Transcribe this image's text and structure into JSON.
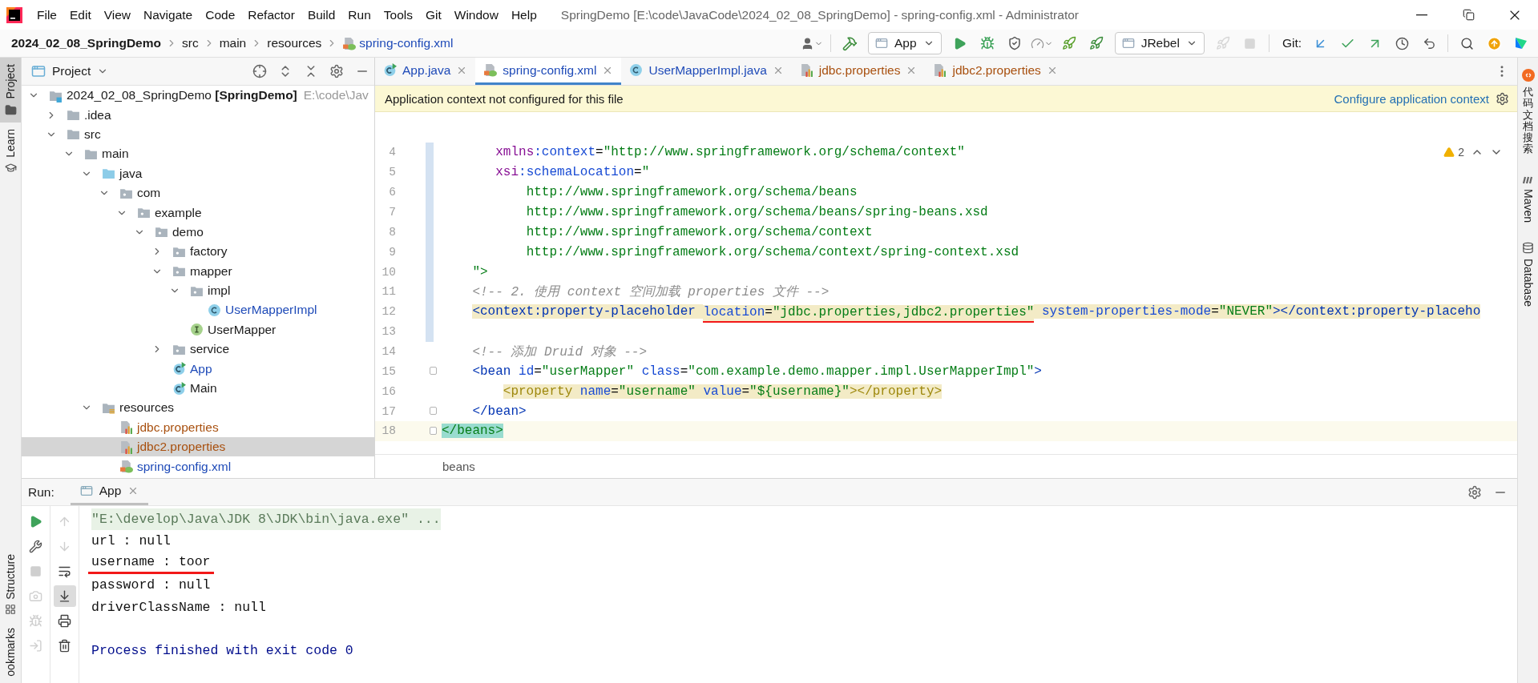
{
  "title_bar": {
    "menu": [
      "File",
      "Edit",
      "View",
      "Navigate",
      "Code",
      "Refactor",
      "Build",
      "Run",
      "Tools",
      "Git",
      "Window",
      "Help"
    ],
    "title": "SpringDemo [E:\\code\\JavaCode\\2024_02_08_SpringDemo] - spring-config.xml - Administrator"
  },
  "nav_bar": {
    "breadcrumbs": [
      {
        "label": "2024_02_08_SpringDemo",
        "kind": "project"
      },
      {
        "label": "src",
        "kind": "folder"
      },
      {
        "label": "main",
        "kind": "folder"
      },
      {
        "label": "resources",
        "kind": "folder"
      },
      {
        "label": "spring-config.xml",
        "kind": "file"
      }
    ],
    "tools": [
      {
        "kind": "user",
        "disabled": false
      },
      {
        "kind": "build",
        "disabled": false
      },
      {
        "kind": "dropdown",
        "label": "App"
      },
      {
        "kind": "run",
        "disabled": false
      },
      {
        "kind": "debug",
        "disabled": false
      },
      {
        "kind": "coverage",
        "disabled": false
      },
      {
        "kind": "profile",
        "disabled": false
      },
      {
        "kind": "jrebel-run",
        "disabled": false
      },
      {
        "kind": "jrebel-debug",
        "disabled": false
      },
      {
        "kind": "dropdown",
        "label": "JRebel"
      },
      {
        "kind": "deploy",
        "disabled": true
      },
      {
        "kind": "stop",
        "disabled": true
      },
      {
        "kind": "label",
        "label": "Git:"
      },
      {
        "kind": "git-update",
        "disabled": false
      },
      {
        "kind": "git-commit",
        "disabled": false
      },
      {
        "kind": "git-push",
        "disabled": false
      },
      {
        "kind": "history",
        "disabled": false
      },
      {
        "kind": "rollback",
        "disabled": false
      },
      {
        "kind": "search",
        "disabled": false
      },
      {
        "kind": "ide-update",
        "disabled": false
      },
      {
        "kind": "logo",
        "disabled": false
      }
    ]
  },
  "left_strip": {
    "top": [
      {
        "label": "Project",
        "kind": "project",
        "selected": true
      },
      {
        "label": "Learn",
        "kind": "learn",
        "selected": false
      }
    ],
    "bottom": [
      {
        "label": "Structure",
        "kind": "structure",
        "selected": false
      },
      {
        "label": "ookmarks",
        "kind": "bookmarks",
        "selected": false
      }
    ]
  },
  "project_panel": {
    "title": "Project",
    "tree": [
      {
        "label": "2024_02_08_SpringDemo",
        "module": "[SpringDemo]",
        "path": "E:\\code\\Jav",
        "kind": "module",
        "expanded": true,
        "selected": false,
        "children": [
          {
            "label": ".idea",
            "kind": "folder",
            "expanded": false,
            "selected": false
          },
          {
            "label": "src",
            "kind": "folder",
            "expanded": true,
            "selected": false,
            "children": [
              {
                "label": "main",
                "kind": "folder",
                "expanded": true,
                "selected": false,
                "children": [
                  {
                    "label": "java",
                    "kind": "source",
                    "expanded": true,
                    "selected": false,
                    "children": [
                      {
                        "label": "com",
                        "kind": "package",
                        "expanded": true,
                        "selected": false,
                        "children": [
                          {
                            "label": "example",
                            "kind": "package",
                            "expanded": true,
                            "selected": false,
                            "children": [
                              {
                                "label": "demo",
                                "kind": "package",
                                "expanded": true,
                                "selected": false,
                                "children": [
                                  {
                                    "label": "factory",
                                    "kind": "package",
                                    "expanded": false,
                                    "selected": false
                                  },
                                  {
                                    "label": "mapper",
                                    "kind": "package",
                                    "expanded": true,
                                    "selected": false,
                                    "children": [
                                      {
                                        "label": "impl",
                                        "kind": "package",
                                        "expanded": true,
                                        "selected": false,
                                        "children": [
                                          {
                                            "label": "UserMapperImpl",
                                            "kind": "class",
                                            "color": "#1f4bb8",
                                            "selected": false
                                          }
                                        ]
                                      },
                                      {
                                        "label": "UserMapper",
                                        "kind": "interface",
                                        "selected": false
                                      }
                                    ]
                                  },
                                  {
                                    "label": "service",
                                    "kind": "package",
                                    "expanded": false,
                                    "selected": false
                                  },
                                  {
                                    "label": "App",
                                    "kind": "runnable",
                                    "color": "#1f4bb8",
                                    "selected": false
                                  },
                                  {
                                    "label": "Main",
                                    "kind": "runnable",
                                    "selected": false
                                  }
                                ]
                              }
                            ]
                          }
                        ]
                      }
                    ]
                  },
                  {
                    "label": "resources",
                    "kind": "resources",
                    "expanded": true,
                    "selected": false,
                    "children": [
                      {
                        "label": "jdbc.properties",
                        "kind": "properties",
                        "color": "#a8500f",
                        "selected": false
                      },
                      {
                        "label": "jdbc2.properties",
                        "kind": "properties",
                        "color": "#a8500f",
                        "selected": true
                      },
                      {
                        "label": "spring-config.xml",
                        "kind": "xml",
                        "color": "#1f4bb8",
                        "selected": false
                      }
                    ]
                  }
                ]
              }
            ]
          }
        ]
      }
    ]
  },
  "editor": {
    "tabs": [
      {
        "label": "App.java",
        "kind": "runnable",
        "color": "#1f4bb8",
        "selected": false
      },
      {
        "label": "spring-config.xml",
        "kind": "xml",
        "color": "#1f4bb8",
        "selected": true
      },
      {
        "label": "UserMapperImpl.java",
        "kind": "class",
        "color": "#1f4bb8",
        "selected": false
      },
      {
        "label": "jdbc.properties",
        "kind": "properties",
        "color": "#a8500f",
        "selected": false
      },
      {
        "label": "jdbc2.properties",
        "kind": "properties",
        "color": "#a8500f",
        "selected": false
      }
    ],
    "banner": {
      "message": "Application context not configured for this file",
      "action": "Configure application context"
    },
    "warnings": "2",
    "lines": [
      {
        "number": "4",
        "changed": true,
        "tokens": [
          {
            "text": "       xmlns",
            "kind": "ns"
          },
          {
            "text": ":context",
            "kind": "attr"
          },
          {
            "text": "=",
            "kind": "text"
          },
          {
            "text": "\"http://www.springframework.org/schema/context\"",
            "kind": "value"
          }
        ]
      },
      {
        "number": "5",
        "changed": true,
        "tokens": [
          {
            "text": "       xsi",
            "kind": "ns"
          },
          {
            "text": ":schemaLocation",
            "kind": "attr"
          },
          {
            "text": "=",
            "kind": "text"
          },
          {
            "text": "\"",
            "kind": "value"
          }
        ]
      },
      {
        "number": "6",
        "changed": true,
        "tokens": [
          {
            "text": "           http://www.springframework.org/schema/beans",
            "kind": "value"
          }
        ]
      },
      {
        "number": "7",
        "changed": true,
        "tokens": [
          {
            "text": "           http://www.springframework.org/schema/beans/spring-beans.xsd",
            "kind": "value"
          }
        ]
      },
      {
        "number": "8",
        "changed": true,
        "tokens": [
          {
            "text": "           http://www.springframework.org/schema/context",
            "kind": "value"
          }
        ]
      },
      {
        "number": "9",
        "changed": true,
        "tokens": [
          {
            "text": "           http://www.springframework.org/schema/context/spring-context.xsd",
            "kind": "value"
          }
        ]
      },
      {
        "number": "10",
        "changed": true,
        "tokens": [
          {
            "text": "    \">",
            "kind": "value"
          }
        ]
      },
      {
        "number": "11",
        "changed": true,
        "tokens": [
          {
            "text": "    <!-- 2. 使用 context 空间加载 properties 文件 -->",
            "kind": "comment"
          }
        ]
      },
      {
        "number": "12",
        "changed": true,
        "highlighted": true,
        "tokens": [
          {
            "text": "    <context:property-placeholder ",
            "kind": "tag"
          },
          {
            "text": "location",
            "kind": "attr",
            "marked": true
          },
          {
            "text": "=",
            "kind": "text",
            "marked": true
          },
          {
            "text": "\"jdbc.properties,jdbc2.properties\"",
            "kind": "value",
            "marked": true
          },
          {
            "text": " system-properties-mode",
            "kind": "attr"
          },
          {
            "text": "=",
            "kind": "text"
          },
          {
            "text": "\"NEVER\"",
            "kind": "value"
          },
          {
            "text": "></context:property-placeho",
            "kind": "tag"
          }
        ]
      },
      {
        "number": "13",
        "changed": true
      },
      {
        "number": "14",
        "tokens": [
          {
            "text": "    <!-- 添加 Druid 对象 -->",
            "kind": "comment"
          }
        ]
      },
      {
        "number": "15",
        "fold": true,
        "tokens": [
          {
            "text": "    <bean",
            "kind": "tag"
          },
          {
            "text": " id",
            "kind": "attr"
          },
          {
            "text": "=",
            "kind": "text"
          },
          {
            "text": "\"userMapper\"",
            "kind": "value"
          },
          {
            "text": " class",
            "kind": "attr"
          },
          {
            "text": "=",
            "kind": "text"
          },
          {
            "text": "\"com.example.demo.mapper.impl.UserMapperImpl\"",
            "kind": "value"
          },
          {
            "text": ">",
            "kind": "tag"
          }
        ]
      },
      {
        "number": "16",
        "highlighted": true,
        "tokens": [
          {
            "text": "        <property",
            "kind": "soft_tag"
          },
          {
            "text": " name",
            "kind": "attr"
          },
          {
            "text": "=",
            "kind": "text"
          },
          {
            "text": "\"username\"",
            "kind": "value"
          },
          {
            "text": " value",
            "kind": "attr"
          },
          {
            "text": "=",
            "kind": "text"
          },
          {
            "text": "\"${username}\"",
            "kind": "value"
          },
          {
            "text": "></property>",
            "kind": "soft_tag"
          }
        ]
      },
      {
        "number": "17",
        "fold": true,
        "tokens": [
          {
            "text": "    </bean>",
            "kind": "tag"
          }
        ]
      },
      {
        "number": "18",
        "fold": true,
        "current": true,
        "tokens": [
          {
            "text": "</beans>",
            "kind": "matched_tag"
          }
        ]
      }
    ],
    "breadcrumb": "beans"
  },
  "run_panel": {
    "label": "Run:",
    "tabs": [
      {
        "label": "App",
        "selected": true
      }
    ],
    "left_tools": [
      {
        "kind": "rerun",
        "disabled": false
      },
      {
        "kind": "settings",
        "disabled": false
      },
      {
        "kind": "stop",
        "disabled": true
      },
      {
        "kind": "snapshot",
        "disabled": true
      },
      {
        "kind": "dump",
        "disabled": true
      },
      {
        "kind": "exit",
        "disabled": true
      }
    ],
    "right_tools": [
      {
        "kind": "up",
        "disabled": true,
        "selected": false
      },
      {
        "kind": "down",
        "disabled": true,
        "selected": false
      },
      {
        "kind": "wrap",
        "disabled": false,
        "selected": false
      },
      {
        "kind": "scroll-end",
        "disabled": false,
        "selected": true
      },
      {
        "kind": "print",
        "disabled": false,
        "selected": false
      },
      {
        "kind": "clear",
        "disabled": false,
        "selected": false
      }
    ],
    "output": [
      {
        "text": "\"E:\\develop\\Java\\JDK 8\\JDK\\bin\\java.exe\" ...",
        "kind": "command"
      },
      {
        "text": "url : null",
        "kind": "normal"
      },
      {
        "text": "username : toor",
        "kind": "normal",
        "marked": true
      },
      {
        "text": "password : null",
        "kind": "normal"
      },
      {
        "text": "driverClassName : null",
        "kind": "normal"
      },
      {
        "text": "Process finished with exit code 0",
        "kind": "exit"
      }
    ]
  },
  "right_strip": [
    {
      "label": "代码文档搜索",
      "kind": "plugin"
    },
    {
      "label": "Maven",
      "kind": "maven"
    },
    {
      "label": "Database",
      "kind": "database"
    }
  ]
}
